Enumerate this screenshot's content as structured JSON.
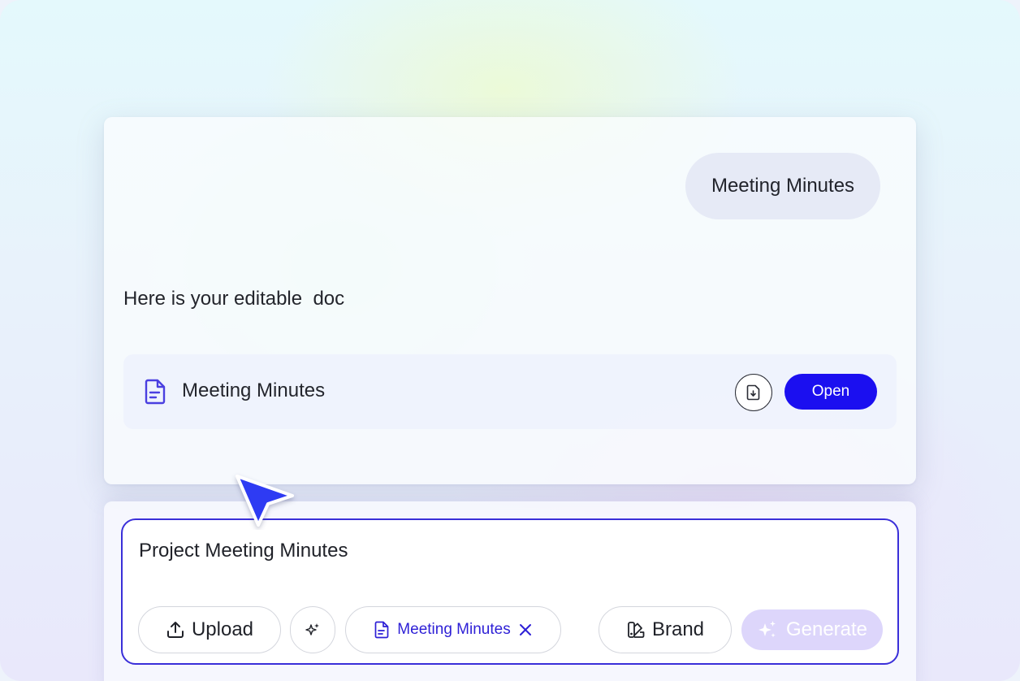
{
  "chat": {
    "user_message": "Meeting Minutes",
    "assistant_reply": "Here is your editable  doc",
    "document": {
      "title": "Meeting Minutes",
      "open_label": "Open",
      "icon": "document-icon",
      "download_icon": "download-file-icon"
    }
  },
  "composer": {
    "prompt": "Project Meeting Minutes",
    "upload_label": "Upload",
    "magic_icon": "sparkle-icon",
    "attached_template": "Meeting Minutes",
    "brand_label": "Brand",
    "generate_label": "Generate"
  },
  "colors": {
    "accent": "#1b0ff0",
    "composer_border": "#3a2fd9",
    "generate_disabled": "#ddd6fb"
  }
}
